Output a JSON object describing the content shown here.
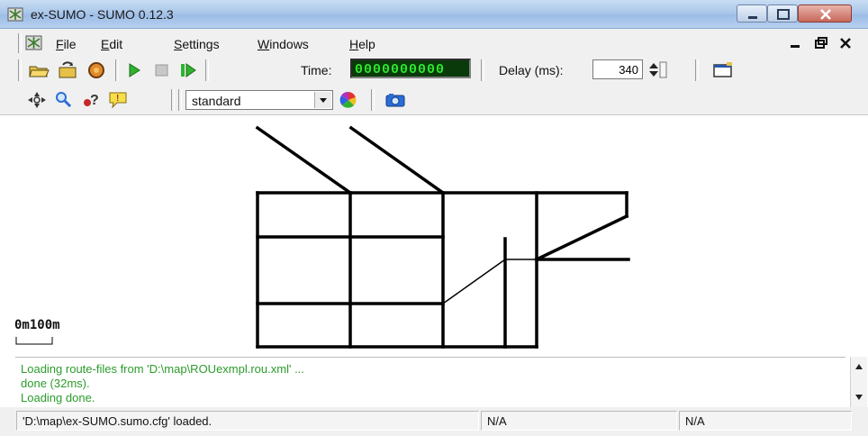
{
  "window": {
    "title": "ex-SUMO - SUMO 0.12.3"
  },
  "menu": {
    "items": [
      "File",
      "Edit",
      "Settings",
      "Windows",
      "Help"
    ]
  },
  "toolbar": {
    "time_label": "Time:",
    "time_value": "0000000000",
    "delay_label": "Delay (ms):",
    "delay_value": "340"
  },
  "view_toolbar": {
    "scheme_selected": "standard"
  },
  "canvas": {
    "scale_label": "0m100m"
  },
  "log": {
    "lines": [
      "Loading route-files from 'D:\\map\\ROUexmpl.rou.xml' ...",
      " done (32ms).",
      "Loading done."
    ]
  },
  "status": {
    "message": "'D:\\map\\ex-SUMO.sumo.cfg' loaded.",
    "cell2": "N/A",
    "cell3": "N/A"
  },
  "icons": {
    "app": "sumo-app-icon",
    "open": "open-folder-icon",
    "reload": "reload-icon",
    "close_sim": "close-simulation-icon",
    "run": "play-icon",
    "stop": "stop-icon",
    "step": "step-icon",
    "new_view": "new-view-icon",
    "recenter": "recenter-icon",
    "locate": "search-icon",
    "query": "query-icon",
    "tooltip": "tooltip-icon",
    "color": "color-wheel-icon",
    "snapshot": "camera-icon"
  },
  "colors": {
    "log_text": "#2c9b2c",
    "time_display": "#2ee62e"
  }
}
